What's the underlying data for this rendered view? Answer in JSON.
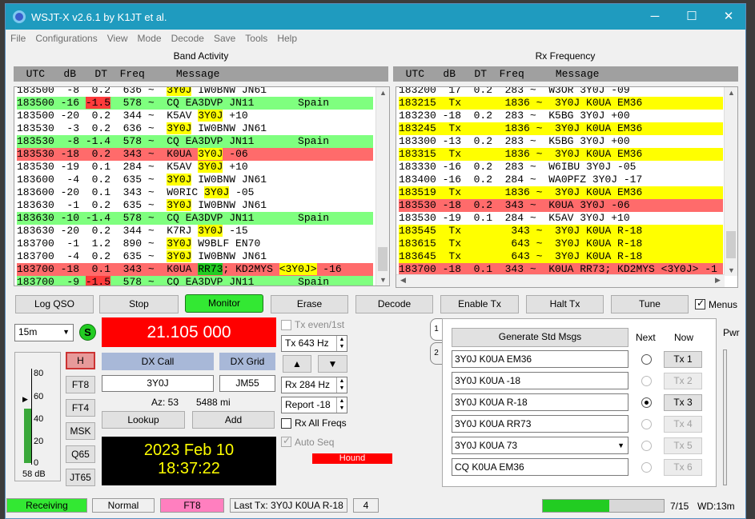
{
  "window": {
    "title": "WSJT-X   v2.6.1   by K1JT et al.",
    "minimize": "─",
    "maximize": "☐",
    "close": "✕"
  },
  "menu": [
    "File",
    "Configurations",
    "View",
    "Mode",
    "Decode",
    "Save",
    "Tools",
    "Help"
  ],
  "band_activity": {
    "title": "Band Activity",
    "header": "  UTC   dB   DT  Freq     Message",
    "rows": [
      {
        "bg": "",
        "pre": "183500  -8  0.2  636 ~  ",
        "hl": "3Y0J",
        "post": " IW0BNW JN61"
      },
      {
        "bg": "g",
        "pre": "183500 -16 ",
        "dt": "-1.5",
        "post": "  578 ~  CQ EA3DVP JN11       Spain"
      },
      {
        "bg": "",
        "pre": "183500 -20  0.2  344 ~  K5AV ",
        "hl": "3Y0J",
        "post": " +10"
      },
      {
        "bg": "",
        "pre": "183530  -3  0.2  636 ~  ",
        "hl": "3Y0J",
        "post": " IW0BNW JN61"
      },
      {
        "bg": "g",
        "pre": "183530  -8 -1.4  578 ~  CQ EA3DVP JN11       Spain"
      },
      {
        "bg": "r",
        "pre": "183530 -18  0.2  343 ~  K0UA ",
        "hl": "3Y0J",
        "post": " -06"
      },
      {
        "bg": "",
        "pre": "183530 -19  0.1  284 ~  K5AV ",
        "hl": "3Y0J",
        "post": " +10"
      },
      {
        "bg": "",
        "pre": "183600  -4  0.2  635 ~  ",
        "hl": "3Y0J",
        "post": " IW0BNW JN61"
      },
      {
        "bg": "",
        "pre": "183600 -20  0.1  343 ~  W0RIC ",
        "hl": "3Y0J",
        "post": " -05"
      },
      {
        "bg": "",
        "pre": "183630  -1  0.2  635 ~  ",
        "hl": "3Y0J",
        "post": " IW0BNW JN61"
      },
      {
        "bg": "g",
        "pre": "183630 -10 -1.4  578 ~  CQ EA3DVP JN11       Spain"
      },
      {
        "bg": "",
        "pre": "183630 -20  0.2  344 ~  K7RJ ",
        "hl": "3Y0J",
        "post": " -15"
      },
      {
        "bg": "",
        "pre": "183700  -1  1.2  890 ~  ",
        "hl": "3Y0J",
        "post": " W9BLF EN70"
      },
      {
        "bg": "",
        "pre": "183700  -4  0.2  635 ~  ",
        "hl": "3Y0J",
        "post": " IW0BNW JN61"
      },
      {
        "bg": "r",
        "pre": "183700 -18  0.1  343 ~  K0UA ",
        "gr": "RR73",
        "mid": "; KD2MYS ",
        "hl": "<3Y0J>",
        "post": " -16"
      },
      {
        "bg": "g",
        "pre": "183700  -9 ",
        "dt": "-1.5",
        "post": "  578 ~  CQ EA3DVP JN11       Spain"
      }
    ]
  },
  "rx_frequency": {
    "title": "Rx Frequency",
    "header": "  UTC   dB   DT  Freq     Message",
    "rows": [
      {
        "bg": "",
        "t": "183200  17  0.2  283 ~  W3OR 3Y0J -09"
      },
      {
        "bg": "y",
        "t": "183215  Tx       1836 ~  3Y0J K0UA EM36"
      },
      {
        "bg": "",
        "t": "183230 -18  0.2  283 ~  K5BG 3Y0J +00"
      },
      {
        "bg": "y",
        "t": "183245  Tx       1836 ~  3Y0J K0UA EM36"
      },
      {
        "bg": "",
        "t": "183300 -13  0.2  283 ~  K5BG 3Y0J +00"
      },
      {
        "bg": "y",
        "t": "183315  Tx       1836 ~  3Y0J K0UA EM36"
      },
      {
        "bg": "",
        "t": "183330 -16  0.2  283 ~  W6IBU 3Y0J -05"
      },
      {
        "bg": "",
        "t": "183400 -16  0.2  284 ~  WA0PFZ 3Y0J -17"
      },
      {
        "bg": "y",
        "t": "183519  Tx       1836 ~  3Y0J K0UA EM36"
      },
      {
        "bg": "r",
        "t": "183530 -18  0.2  343 ~  K0UA 3Y0J -06"
      },
      {
        "bg": "",
        "t": "183530 -19  0.1  284 ~  K5AV 3Y0J +10"
      },
      {
        "bg": "y",
        "t": "183545  Tx        343 ~  3Y0J K0UA R-18"
      },
      {
        "bg": "y",
        "t": "183615  Tx        643 ~  3Y0J K0UA R-18"
      },
      {
        "bg": "y",
        "t": "183645  Tx        643 ~  3Y0J K0UA R-18"
      },
      {
        "bg": "r",
        "t": "183700 -18  0.1  343 ~  K0UA RR73; KD2MYS <3Y0J> -1"
      }
    ]
  },
  "buttons": {
    "log_qso": "Log QSO",
    "stop": "Stop",
    "monitor": "Monitor",
    "erase": "Erase",
    "decode": "Decode",
    "enable_tx": "Enable Tx",
    "halt_tx": "Halt Tx",
    "tune": "Tune",
    "menus": "Menus"
  },
  "band": {
    "value": "15m",
    "s_label": "S"
  },
  "frequency": "21.105 000",
  "meter": {
    "ticks": [
      "80",
      "60",
      "40",
      "20",
      "0"
    ],
    "level_db": "58 dB",
    "level_fraction": 0.58
  },
  "modes": {
    "h": "H",
    "ft8": "FT8",
    "ft4": "FT4",
    "msk": "MSK",
    "q65": "Q65",
    "jt65": "JT65"
  },
  "dx": {
    "call_label": "DX Call",
    "grid_label": "DX Grid",
    "call": "3Y0J",
    "grid": "JM55",
    "az": "Az: 53",
    "dist": "5488 mi",
    "lookup": "Lookup",
    "add": "Add"
  },
  "clock": {
    "date": "2023 Feb 10",
    "time": "18:37:22"
  },
  "tx_controls": {
    "tx_even": "Tx even/1st",
    "tx_hz": "Tx  643 Hz",
    "rx_hz": "Rx  284 Hz",
    "report": "Report -18",
    "rx_all": "Rx All Freqs",
    "auto_seq": "Auto Seq",
    "hound": "Hound",
    "up": "▲",
    "down": "▼"
  },
  "messages": {
    "generate": "Generate Std Msgs",
    "next": "Next",
    "now": "Now",
    "tab1": "1",
    "tab2": "2",
    "pwr": "Pwr",
    "items": [
      {
        "text": "3Y0J K0UA EM36",
        "tx": "Tx 1",
        "dis": false,
        "sel": false
      },
      {
        "text": "3Y0J K0UA -18",
        "tx": "Tx 2",
        "dis": true,
        "sel": false
      },
      {
        "text": "3Y0J K0UA R-18",
        "tx": "Tx 3",
        "dis": false,
        "sel": true
      },
      {
        "text": "3Y0J K0UA RR73",
        "tx": "Tx 4",
        "dis": true,
        "sel": false
      },
      {
        "text": "3Y0J K0UA 73",
        "tx": "Tx 5",
        "dis": true,
        "sel": false
      },
      {
        "text": "CQ  K0UA EM36",
        "tx": "Tx 6",
        "dis": true,
        "sel": false
      }
    ]
  },
  "status": {
    "receiving": "Receiving",
    "mode": "Normal",
    "submode": "FT8",
    "last_tx": "Last Tx: 3Y0J K0UA R-18",
    "count": "4",
    "progress_fraction": 0.55,
    "period": "7/15",
    "wd": "WD:13m"
  },
  "colors": {
    "green": "#7fff7f",
    "red": "#ff6b6b",
    "yellow": "#ffff00",
    "title": "#1f9bbf",
    "freq_bg": "#ff0000"
  }
}
